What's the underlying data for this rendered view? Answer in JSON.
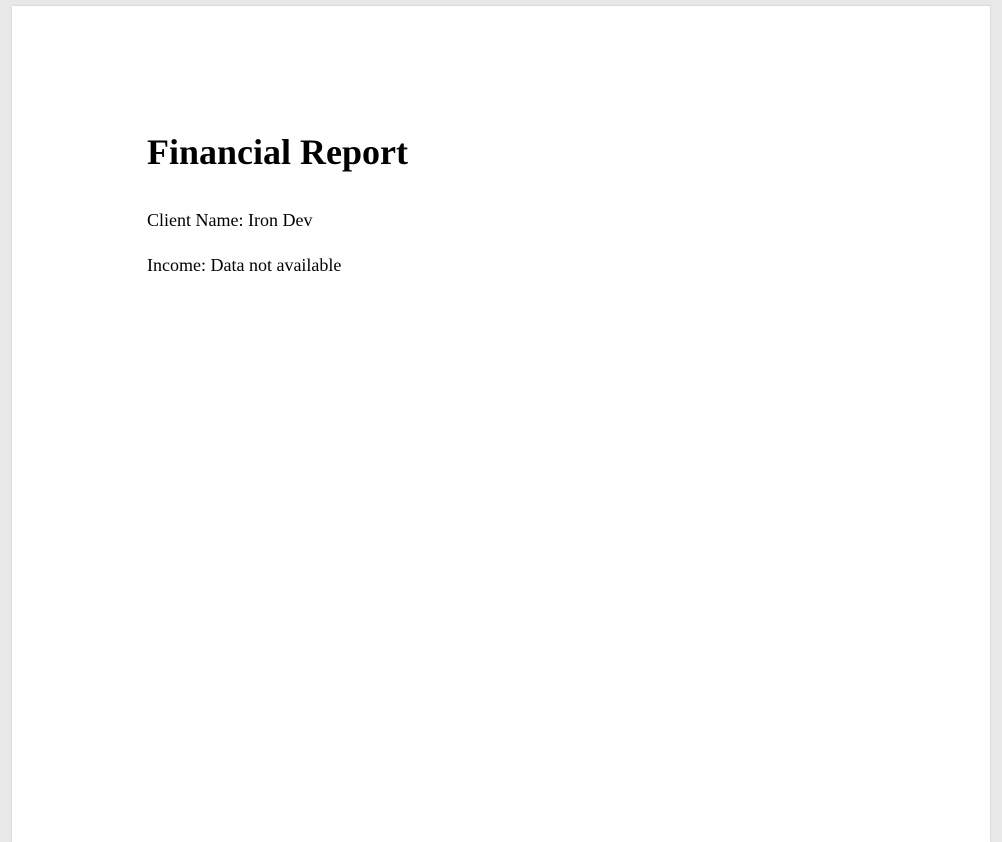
{
  "report": {
    "title": "Financial Report",
    "client_line": "Client Name: Iron Dev",
    "income_line": "Income: Data not available"
  }
}
